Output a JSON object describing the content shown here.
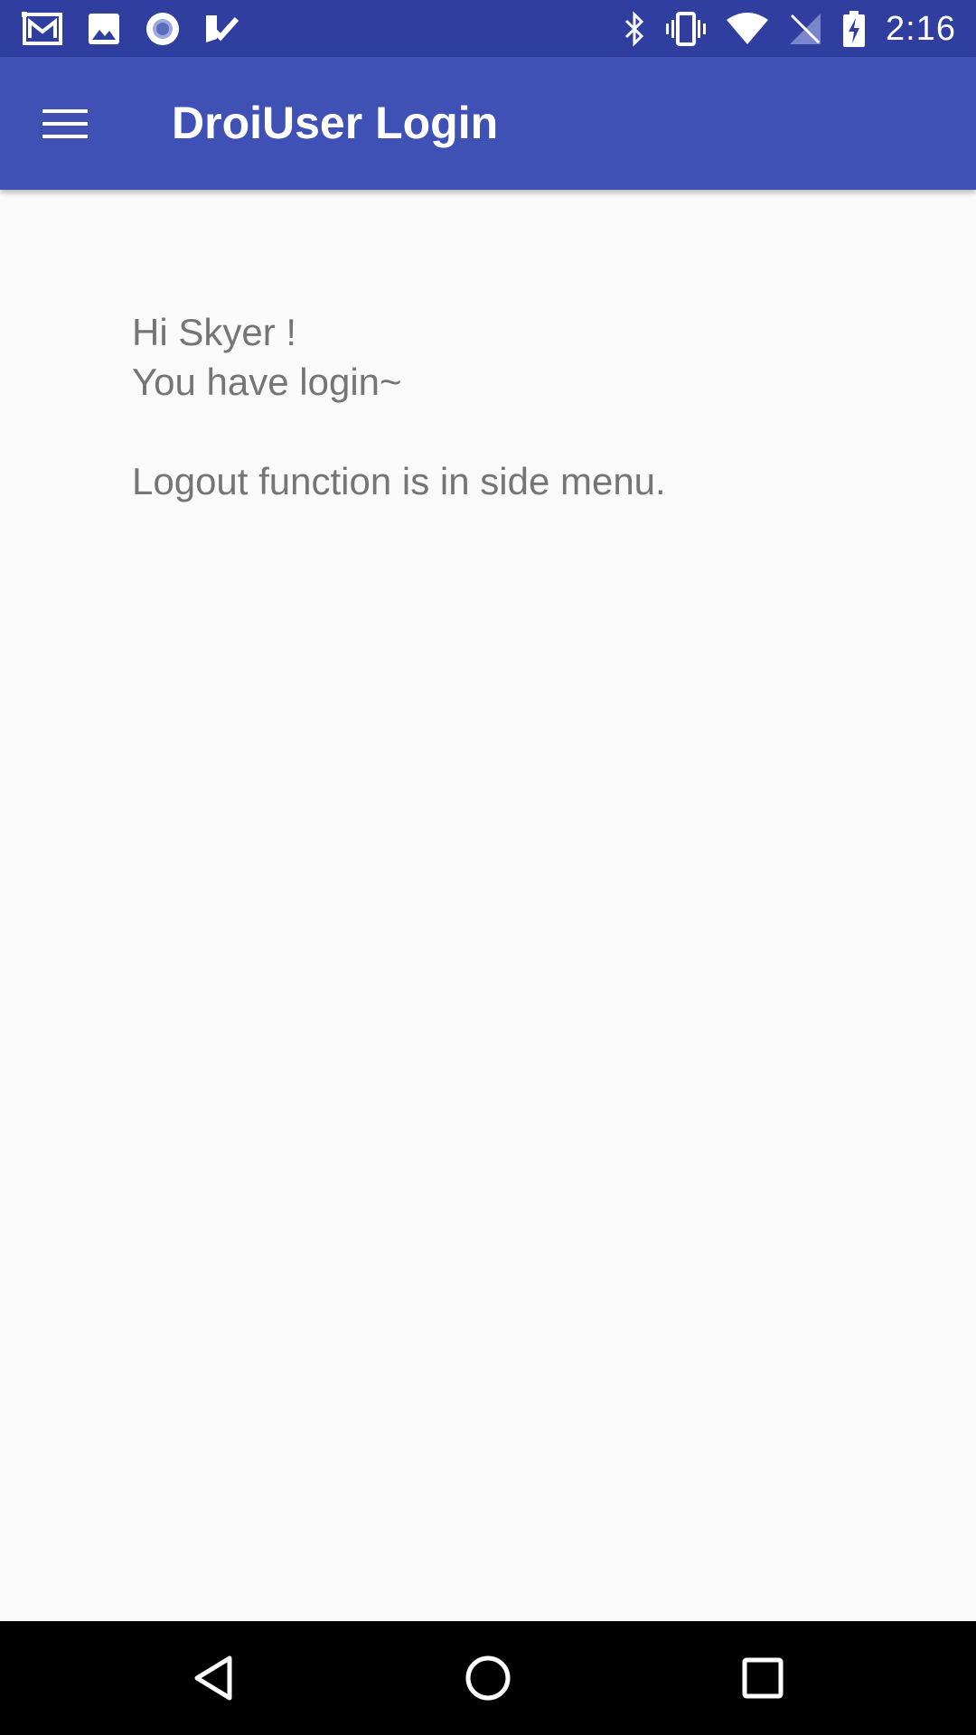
{
  "status_bar": {
    "time": "2:16",
    "background": "#303f9f",
    "left_icons": [
      "gmail-icon",
      "image-icon",
      "radio-circle-icon",
      "task-check-icon"
    ],
    "right_icons": [
      "bluetooth-icon",
      "vibrate-icon",
      "wifi-icon",
      "no-signal-icon",
      "battery-charging-icon"
    ]
  },
  "app_bar": {
    "title": "DroiUser Login",
    "menu_icon": "menu-icon",
    "background": "#3f51b5"
  },
  "content": {
    "greeting": "Hi Skyer !",
    "status_message": "You have login~",
    "hint": "Logout function is in side menu.",
    "text_color": "#757575"
  },
  "nav_bar": {
    "buttons": [
      "back-icon",
      "home-icon",
      "recents-icon"
    ]
  }
}
